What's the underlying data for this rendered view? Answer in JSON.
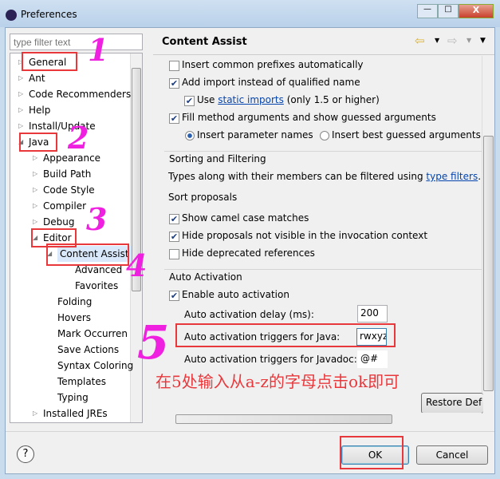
{
  "window": {
    "title": "Preferences",
    "min": "—",
    "max": "□",
    "close": "X"
  },
  "filter": {
    "placeholder": "type filter text"
  },
  "tree": [
    {
      "label": "General",
      "level": 0,
      "twisty": "▷"
    },
    {
      "label": "Ant",
      "level": 0,
      "twisty": "▷"
    },
    {
      "label": "Code Recommenders",
      "level": 0,
      "twisty": "▷"
    },
    {
      "label": "Help",
      "level": 0,
      "twisty": "▷"
    },
    {
      "label": "Install/Update",
      "level": 0,
      "twisty": "▷"
    },
    {
      "label": "Java",
      "level": 0,
      "twisty": "◢"
    },
    {
      "label": "Appearance",
      "level": 1,
      "twisty": "▷"
    },
    {
      "label": "Build Path",
      "level": 1,
      "twisty": "▷"
    },
    {
      "label": "Code Style",
      "level": 1,
      "twisty": "▷"
    },
    {
      "label": "Compiler",
      "level": 1,
      "twisty": "▷"
    },
    {
      "label": "Debug",
      "level": 1,
      "twisty": "▷"
    },
    {
      "label": "Editor",
      "level": 1,
      "twisty": "◢"
    },
    {
      "label": "Content Assist",
      "level": 2,
      "twisty": "◢",
      "selected": true
    },
    {
      "label": "Advanced",
      "level": 3,
      "twisty": ""
    },
    {
      "label": "Favorites",
      "level": 3,
      "twisty": ""
    },
    {
      "label": "Folding",
      "level": 2,
      "twisty": ""
    },
    {
      "label": "Hovers",
      "level": 2,
      "twisty": ""
    },
    {
      "label": "Mark Occurren",
      "level": 2,
      "twisty": ""
    },
    {
      "label": "Save Actions",
      "level": 2,
      "twisty": ""
    },
    {
      "label": "Syntax Coloring",
      "level": 2,
      "twisty": ""
    },
    {
      "label": "Templates",
      "level": 2,
      "twisty": ""
    },
    {
      "label": "Typing",
      "level": 2,
      "twisty": ""
    },
    {
      "label": "Installed JREs",
      "level": 1,
      "twisty": "▷"
    }
  ],
  "page": {
    "title": "Content Assist",
    "opt_prefixes": "Insert common prefixes automatically",
    "opt_import": "Add import instead of qualified name",
    "opt_static_use": "Use",
    "opt_static_link": "static imports",
    "opt_static_rest": "(only 1.5 or higher)",
    "opt_fill": "Fill method arguments and show guessed arguments",
    "radio_param": "Insert parameter names",
    "radio_guess": "Insert best guessed arguments",
    "sorting_title": "Sorting and Filtering",
    "types_text": "Types along with their members can be filtered using",
    "types_link": "type filters",
    "types_end": ".",
    "sort_proposals": "Sort proposals",
    "opt_camel": "Show camel case matches",
    "opt_hide_invis": "Hide proposals not visible in the invocation context",
    "opt_hide_depr": "Hide deprecated references",
    "auto_title": "Auto Activation",
    "opt_enable_auto": "Enable auto activation",
    "delay_label": "Auto activation delay (ms):",
    "delay_value": "200",
    "java_label": "Auto activation triggers for Java:",
    "java_value": "rwxyz",
    "javadoc_label": "Auto activation triggers for Javadoc:",
    "javadoc_value": "@#",
    "restore": "Restore Def"
  },
  "checks": {
    "prefixes": false,
    "import": true,
    "static": true,
    "fill": true,
    "camel": true,
    "hide_invis": true,
    "hide_depr": false,
    "enable_auto": true
  },
  "buttons": {
    "ok": "OK",
    "cancel": "Cancel",
    "help": "?"
  },
  "annotations": {
    "n1": "1",
    "n2": "2",
    "n3": "3",
    "n4": "4",
    "n5": "5",
    "note": "在5处输入从a-z的字母点击ok即可",
    "color": "#e8383c"
  }
}
